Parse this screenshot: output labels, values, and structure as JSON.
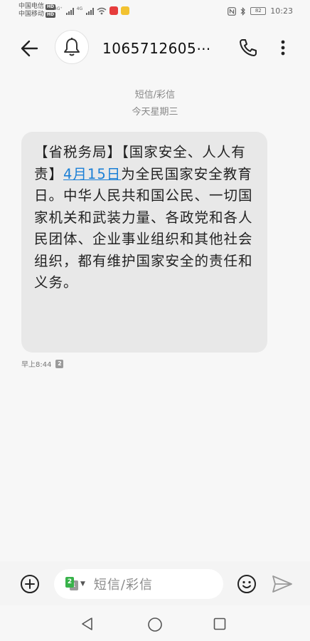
{
  "status_bar": {
    "carrier_1": "中国电信",
    "carrier_2": "中国移动",
    "hd": "HD",
    "network_1": "4G⁺",
    "network_2": "4G",
    "battery": "82",
    "time": "10:23"
  },
  "header": {
    "contact_name": "1065712605⋯"
  },
  "conversation": {
    "message_type": "短信/彩信",
    "date_label": "今天星期三"
  },
  "message": {
    "text_before_link": "【省税务局】【国家安全、人人有责】",
    "link_text": "4月15日",
    "text_after_link": "为全民国家安全教育日。中华人民共和国公民、一切国家机关和武装力量、各政党和各人民团体、企业事业组织和其他社会组织，都有维护国家安全的责任和义务。",
    "time": "早上8:44",
    "sim_slot": "2"
  },
  "input_bar": {
    "sim_primary": "2",
    "sim_secondary": "1",
    "placeholder": "短信/彩信"
  },
  "colors": {
    "link": "#1a7fd6",
    "bubble": "#e8e8e8",
    "sim_green": "#38b24a"
  },
  "icons": [
    "back-arrow-icon",
    "bell-icon",
    "phone-icon",
    "more-vertical-icon",
    "add-circle-icon",
    "emoji-icon",
    "send-icon",
    "nav-back-icon",
    "nav-home-icon",
    "nav-recent-icon"
  ]
}
